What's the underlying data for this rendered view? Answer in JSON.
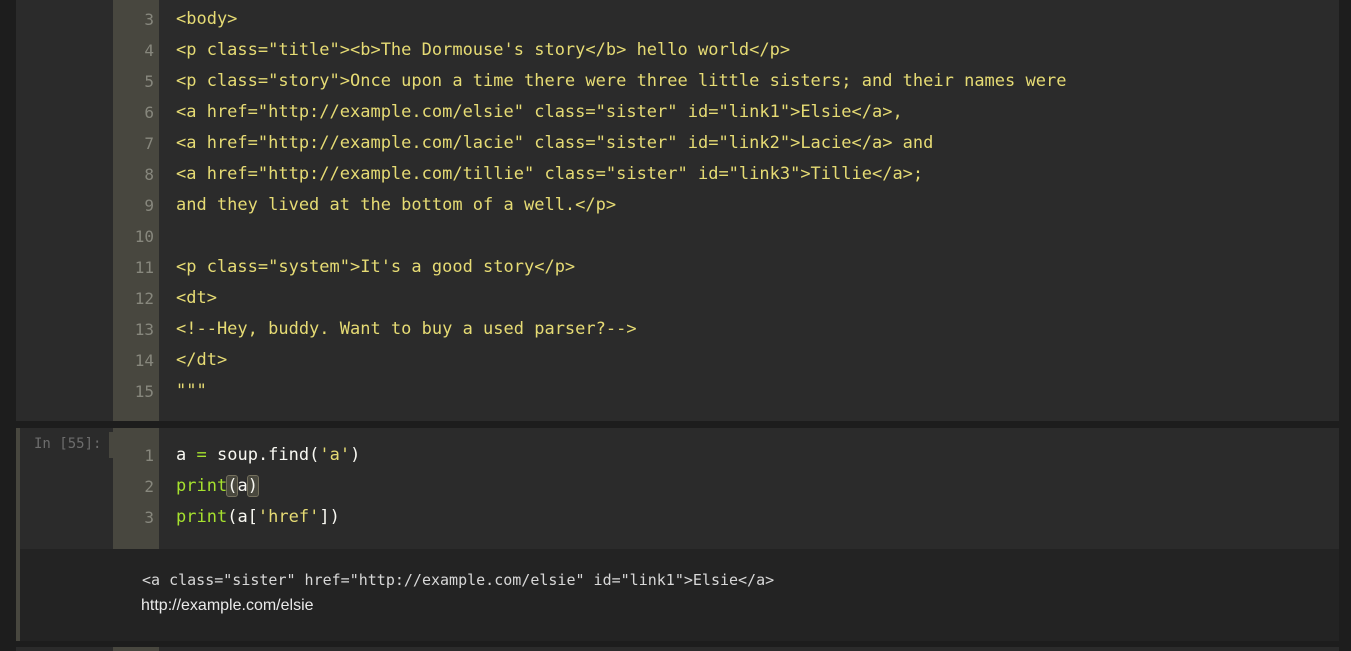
{
  "previous_cell": {
    "lines": [
      {
        "num": "3",
        "text": "<body>"
      },
      {
        "num": "4",
        "text": "<p class=\"title\"><b>The Dormouse's story</b> hello world</p>"
      },
      {
        "num": "5",
        "text": "<p class=\"story\">Once upon a time there were three little sisters; and their names were"
      },
      {
        "num": "6",
        "text": "<a href=\"http://example.com/elsie\" class=\"sister\" id=\"link1\">Elsie</a>,"
      },
      {
        "num": "7",
        "text": "<a href=\"http://example.com/lacie\" class=\"sister\" id=\"link2\">Lacie</a> and"
      },
      {
        "num": "8",
        "text": "<a href=\"http://example.com/tillie\" class=\"sister\" id=\"link3\">Tillie</a>;"
      },
      {
        "num": "9",
        "text": "and they lived at the bottom of a well.</p>"
      },
      {
        "num": "10",
        "text": ""
      },
      {
        "num": "11",
        "text": "<p class=\"system\">It's a good story</p>"
      },
      {
        "num": "12",
        "text": "<dt>"
      },
      {
        "num": "13",
        "text": "<!--Hey, buddy. Want to buy a used parser?-->"
      },
      {
        "num": "14",
        "text": "</dt>"
      },
      {
        "num": "15",
        "text": "\"\"\""
      }
    ]
  },
  "current_cell": {
    "prompt": "In [55]:",
    "line_numbers": [
      "1",
      "2",
      "3"
    ],
    "line1": {
      "var": "a",
      "op": "=",
      "rest": "soup.find(",
      "str": "'a'",
      "close": ")"
    },
    "line2": {
      "fn": "print",
      "open": "(",
      "arg": "a",
      "close": ")"
    },
    "line3": {
      "fn": "print",
      "open": "(",
      "arg": "a[",
      "str": "'href'",
      "close": "])"
    }
  },
  "output": {
    "line1": "<a class=\"sister\" href=\"http://example.com/elsie\" id=\"link1\">Elsie</a>",
    "line2": "http://example.com/elsie"
  },
  "colors": {
    "background": "#1d1d1d",
    "cell_background": "#2b2b2b",
    "gutter": "#48473f",
    "string": "#e6db74",
    "keyword_green": "#a6e22e",
    "text": "#f8f8f2"
  }
}
